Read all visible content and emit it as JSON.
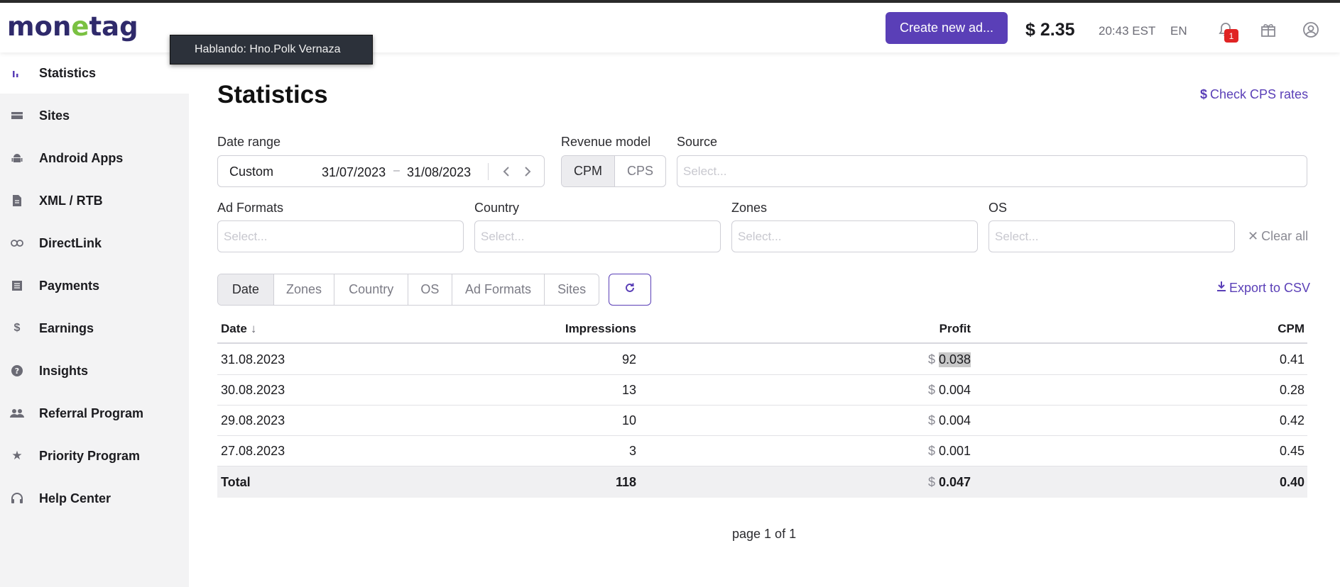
{
  "header": {
    "logo_pre": "mon",
    "logo_e": "e",
    "logo_post": "tag",
    "create_button": "Create new ad...",
    "balance": "$ 2.35",
    "time": "20:43 EST",
    "language": "EN",
    "notification_count": "1",
    "icons": [
      "bell-icon",
      "gift-icon",
      "account-icon"
    ]
  },
  "tooltip": "Hablando: Hno.Polk Vernaza",
  "sidebar": {
    "items": [
      {
        "label": "Statistics",
        "icon": "bar-chart-icon",
        "active": true
      },
      {
        "label": "Sites",
        "icon": "sites-icon"
      },
      {
        "label": "Android Apps",
        "icon": "android-icon"
      },
      {
        "label": "XML / RTB",
        "icon": "document-icon"
      },
      {
        "label": "DirectLink",
        "icon": "link-icon"
      },
      {
        "label": "Payments",
        "icon": "payments-icon"
      },
      {
        "label": "Earnings",
        "icon": "dollar-icon"
      },
      {
        "label": "Insights",
        "icon": "help-circle-icon"
      },
      {
        "label": "Referral Program",
        "icon": "people-icon"
      },
      {
        "label": "Priority Program",
        "icon": "star-icon"
      },
      {
        "label": "Help Center",
        "icon": "headset-icon"
      }
    ]
  },
  "main": {
    "title": "Statistics",
    "cps_link": "Check CPS rates",
    "date_range": {
      "label": "Date range",
      "type": "Custom",
      "from": "31/07/2023",
      "dash": "–",
      "to": "31/08/2023"
    },
    "revenue_model": {
      "label": "Revenue model",
      "options": [
        "CPM",
        "CPS"
      ],
      "selected": "CPM"
    },
    "source": {
      "label": "Source",
      "placeholder": "Select..."
    },
    "ad_formats": {
      "label": "Ad Formats",
      "placeholder": "Select..."
    },
    "country": {
      "label": "Country",
      "placeholder": "Select..."
    },
    "zones": {
      "label": "Zones",
      "placeholder": "Select..."
    },
    "os": {
      "label": "OS",
      "placeholder": "Select..."
    },
    "clear_all": "Clear all",
    "group_by": {
      "options": [
        "Date",
        "Zones",
        "Country",
        "OS",
        "Ad Formats",
        "Sites"
      ],
      "selected": "Date"
    },
    "export": "Export to CSV",
    "table": {
      "columns": [
        "Date",
        "Impressions",
        "Profit",
        "CPM"
      ],
      "currency": "$",
      "rows": [
        {
          "date": "31.08.2023",
          "impressions": "92",
          "profit": "0.038",
          "cpm": "0.41"
        },
        {
          "date": "30.08.2023",
          "impressions": "13",
          "profit": "0.004",
          "cpm": "0.28"
        },
        {
          "date": "29.08.2023",
          "impressions": "10",
          "profit": "0.004",
          "cpm": "0.42"
        },
        {
          "date": "27.08.2023",
          "impressions": "3",
          "profit": "0.001",
          "cpm": "0.45"
        }
      ],
      "total": {
        "label": "Total",
        "impressions": "118",
        "profit": "0.047",
        "cpm": "0.40"
      }
    },
    "pagination": "page 1 of 1"
  },
  "colors": {
    "brand": "#5a3fb7",
    "logo_dark": "#2f2a6b",
    "logo_green": "#7ac142",
    "badge_red": "#e02424"
  }
}
